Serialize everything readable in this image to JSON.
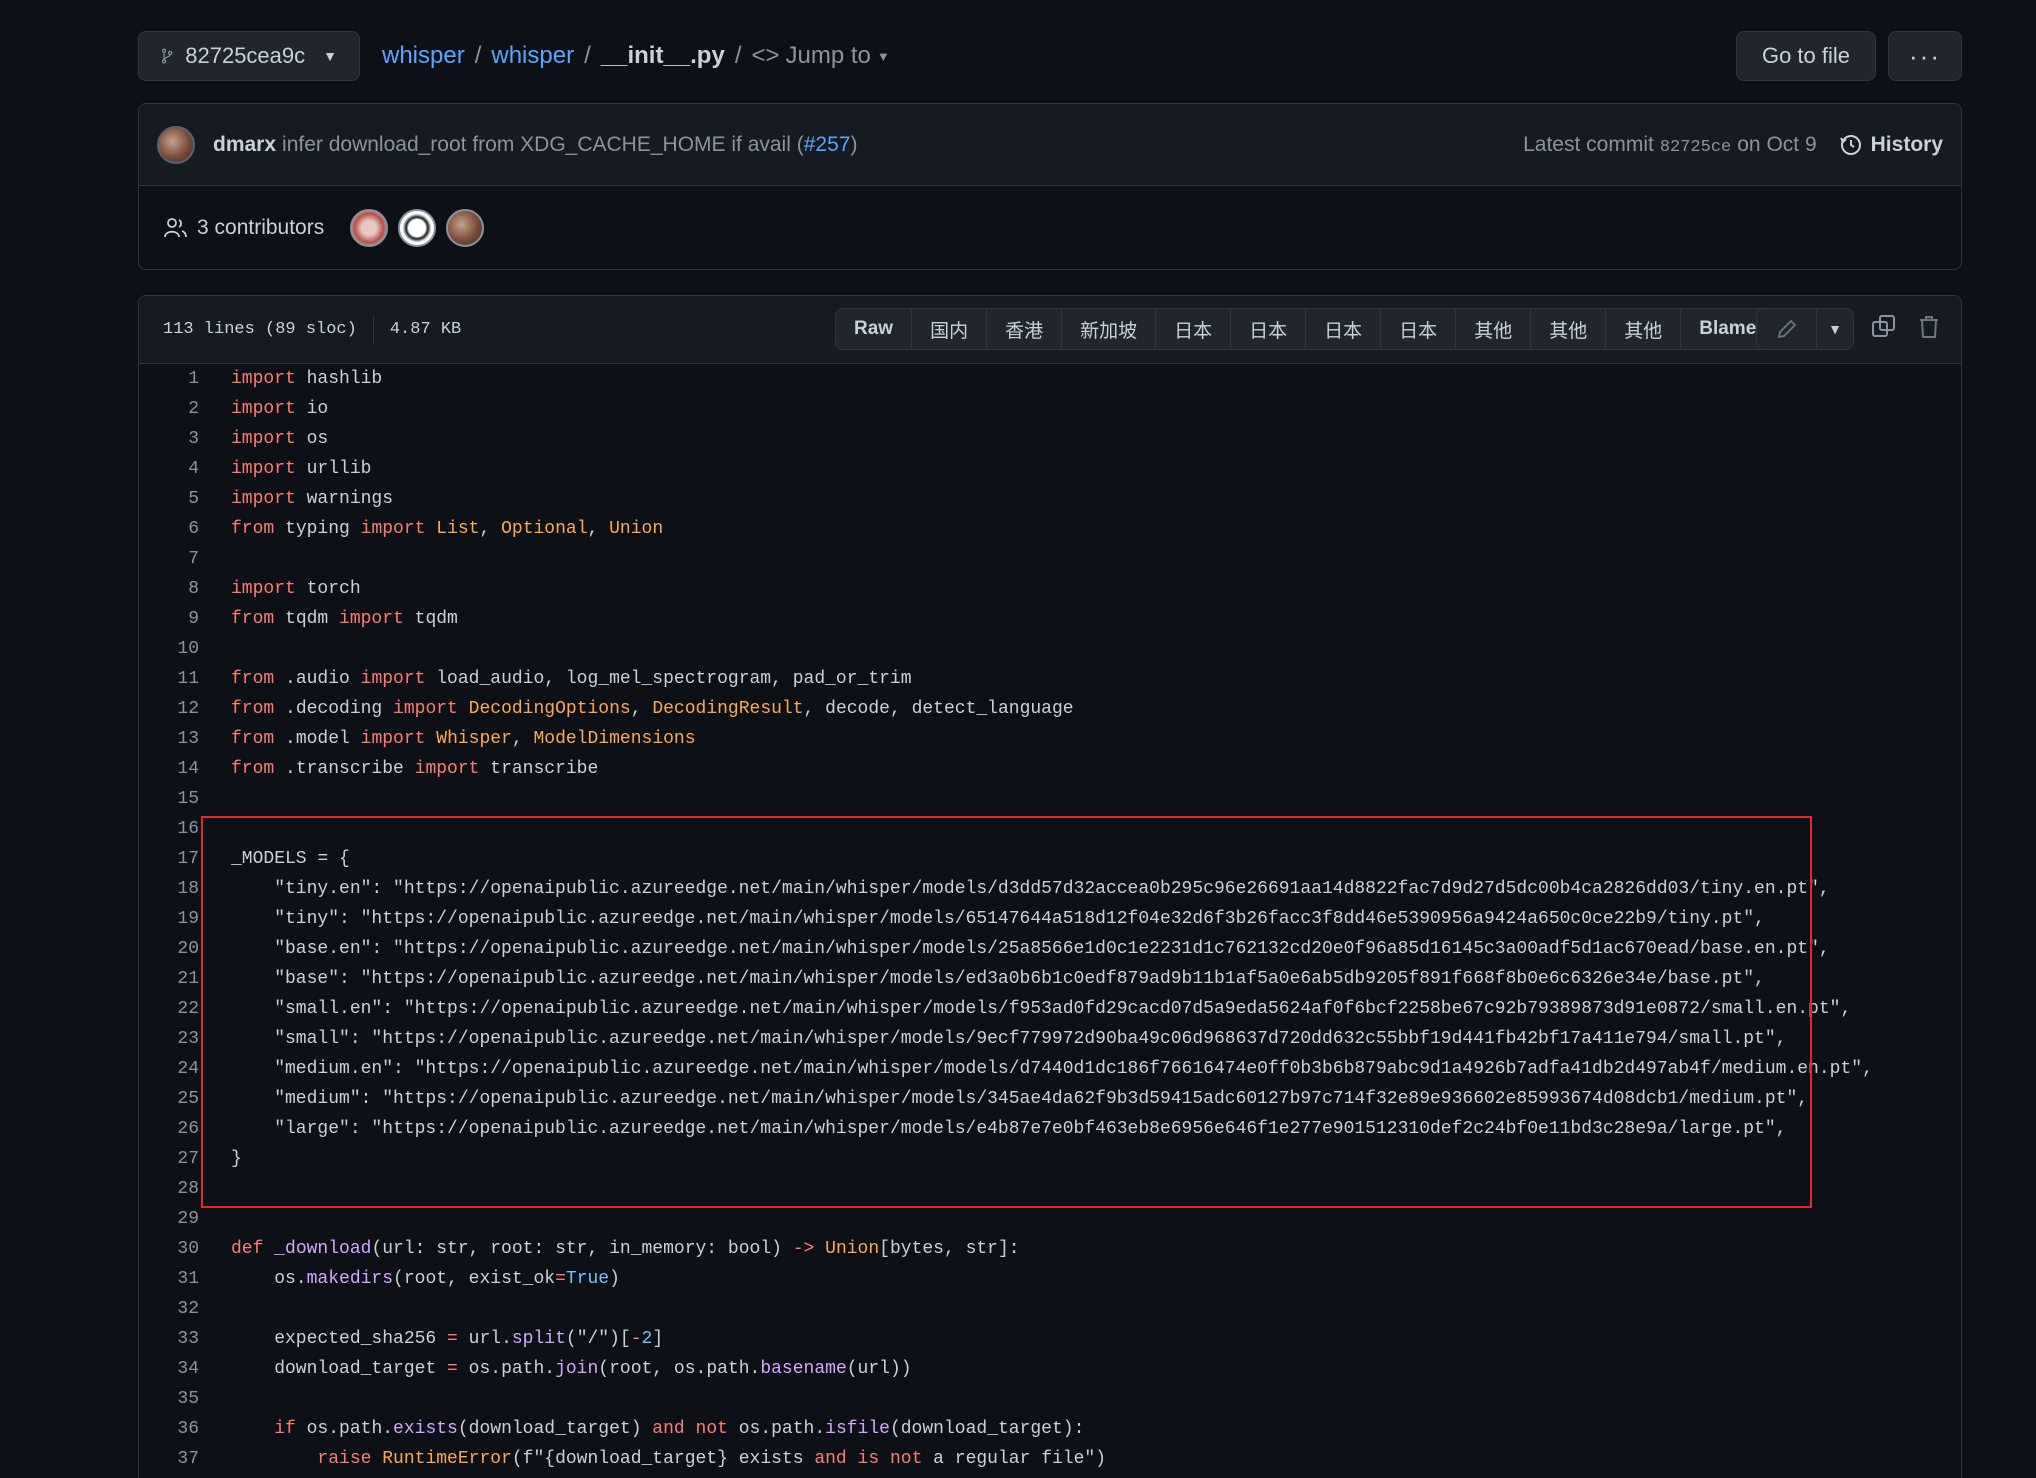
{
  "branch": {
    "name": "82725cea9c"
  },
  "breadcrumb": {
    "repo": "whisper",
    "folder": "whisper",
    "file": "__init__.py",
    "jump_to": "Jump to"
  },
  "toolbar": {
    "goto_file": "Go to file",
    "more": "···"
  },
  "commit": {
    "author": "dmarx",
    "message": "infer download_root from XDG_CACHE_HOME if avail (",
    "pr": "#257",
    "message_end": ")",
    "latest_label": "Latest commit",
    "sha": "82725ce",
    "date": "on Oct 9",
    "history": "History"
  },
  "contributors": {
    "label": "3 contributors"
  },
  "file_info": {
    "lines": "113 lines (89 sloc)",
    "size": "4.87 KB"
  },
  "view_buttons": [
    "Raw",
    "国内",
    "香港",
    "新加坡",
    "日本",
    "日本",
    "日本",
    "日本",
    "其他",
    "其他",
    "其他",
    "Blame"
  ],
  "code": [
    {
      "n": "1",
      "t": [
        [
          "kw",
          "import"
        ],
        [
          "",
          "hashlib"
        ]
      ]
    },
    {
      "n": "2",
      "t": [
        [
          "kw",
          "import"
        ],
        [
          "",
          "io"
        ]
      ]
    },
    {
      "n": "3",
      "t": [
        [
          "kw",
          "import"
        ],
        [
          "",
          "os"
        ]
      ]
    },
    {
      "n": "4",
      "t": [
        [
          "kw",
          "import"
        ],
        [
          "",
          "urllib"
        ]
      ]
    },
    {
      "n": "5",
      "t": [
        [
          "kw",
          "import"
        ],
        [
          "",
          "warnings"
        ]
      ]
    },
    {
      "n": "6",
      "t": [
        [
          "kw",
          "from"
        ],
        [
          "",
          " typing "
        ],
        [
          "kw",
          "import"
        ],
        [
          "",
          " "
        ],
        [
          "cls",
          "List"
        ],
        [
          "",
          ", "
        ],
        [
          "cls",
          "Optional"
        ],
        [
          "",
          ", "
        ],
        [
          "cls",
          "Union"
        ]
      ]
    },
    {
      "n": "7",
      "t": []
    },
    {
      "n": "8",
      "t": [
        [
          "kw",
          "import"
        ],
        [
          "",
          " torch"
        ]
      ]
    },
    {
      "n": "9",
      "t": [
        [
          "kw",
          "from"
        ],
        [
          "",
          " tqdm "
        ],
        [
          "kw",
          "import"
        ],
        [
          "",
          " tqdm"
        ]
      ]
    },
    {
      "n": "10",
      "t": []
    },
    {
      "n": "11",
      "t": [
        [
          "kw",
          "from"
        ],
        [
          "",
          " .audio "
        ],
        [
          "kw",
          "import"
        ],
        [
          "",
          " load_audio, log_mel_spectrogram, pad_or_trim"
        ]
      ]
    },
    {
      "n": "12",
      "t": [
        [
          "kw",
          "from"
        ],
        [
          "",
          " .decoding "
        ],
        [
          "kw",
          "import"
        ],
        [
          "",
          " "
        ],
        [
          "cls",
          "DecodingOptions"
        ],
        [
          "",
          ", "
        ],
        [
          "cls",
          "DecodingResult"
        ],
        [
          "",
          ", decode, detect_language"
        ]
      ]
    },
    {
      "n": "13",
      "t": [
        [
          "kw",
          "from"
        ],
        [
          "",
          " .model "
        ],
        [
          "kw",
          "import"
        ],
        [
          "",
          " "
        ],
        [
          "cls",
          "Whisper"
        ],
        [
          "",
          ", "
        ],
        [
          "cls",
          "ModelDimensions"
        ]
      ]
    },
    {
      "n": "14",
      "t": [
        [
          "kw",
          "from"
        ],
        [
          "",
          " .transcribe "
        ],
        [
          "kw",
          "import"
        ],
        [
          "",
          " transcribe"
        ]
      ]
    },
    {
      "n": "15",
      "t": []
    },
    {
      "n": "16",
      "t": []
    },
    {
      "n": "17",
      "t": [
        [
          "",
          "_MODELS = {"
        ]
      ]
    },
    {
      "n": "18",
      "t": [
        [
          "",
          "    \"tiny.en\": \"https://openaipublic.azureedge.net/main/whisper/models/d3dd57d32accea0b295c96e26691aa14d8822fac7d9d27d5dc00b4ca2826dd03/tiny.en.pt\","
        ]
      ]
    },
    {
      "n": "19",
      "t": [
        [
          "",
          "    \"tiny\": \"https://openaipublic.azureedge.net/main/whisper/models/65147644a518d12f04e32d6f3b26facc3f8dd46e5390956a9424a650c0ce22b9/tiny.pt\","
        ]
      ]
    },
    {
      "n": "20",
      "t": [
        [
          "",
          "    \"base.en\": \"https://openaipublic.azureedge.net/main/whisper/models/25a8566e1d0c1e2231d1c762132cd20e0f96a85d16145c3a00adf5d1ac670ead/base.en.pt\","
        ]
      ]
    },
    {
      "n": "21",
      "t": [
        [
          "",
          "    \"base\": \"https://openaipublic.azureedge.net/main/whisper/models/ed3a0b6b1c0edf879ad9b11b1af5a0e6ab5db9205f891f668f8b0e6c6326e34e/base.pt\","
        ]
      ]
    },
    {
      "n": "22",
      "t": [
        [
          "",
          "    \"small.en\": \"https://openaipublic.azureedge.net/main/whisper/models/f953ad0fd29cacd07d5a9eda5624af0f6bcf2258be67c92b79389873d91e0872/small.en.pt\","
        ]
      ]
    },
    {
      "n": "23",
      "t": [
        [
          "",
          "    \"small\": \"https://openaipublic.azureedge.net/main/whisper/models/9ecf779972d90ba49c06d968637d720dd632c55bbf19d441fb42bf17a411e794/small.pt\","
        ]
      ]
    },
    {
      "n": "24",
      "t": [
        [
          "",
          "    \"medium.en\": \"https://openaipublic.azureedge.net/main/whisper/models/d7440d1dc186f76616474e0ff0b3b6b879abc9d1a4926b7adfa41db2d497ab4f/medium.en.pt\","
        ]
      ]
    },
    {
      "n": "25",
      "t": [
        [
          "",
          "    \"medium\": \"https://openaipublic.azureedge.net/main/whisper/models/345ae4da62f9b3d59415adc60127b97c714f32e89e936602e85993674d08dcb1/medium.pt\","
        ]
      ]
    },
    {
      "n": "26",
      "t": [
        [
          "",
          "    \"large\": \"https://openaipublic.azureedge.net/main/whisper/models/e4b87e7e0bf463eb8e6956e646f1e277e901512310def2c24bf0e11bd3c28e9a/large.pt\","
        ]
      ]
    },
    {
      "n": "27",
      "t": [
        [
          "",
          "}"
        ]
      ]
    },
    {
      "n": "28",
      "t": []
    },
    {
      "n": "29",
      "t": []
    },
    {
      "n": "30",
      "t": [
        [
          "kw",
          "def"
        ],
        [
          "",
          " "
        ],
        [
          "fn",
          "_download"
        ],
        [
          "",
          "(url: str, root: str, in_memory: bool) "
        ],
        [
          "kw",
          "->"
        ],
        [
          "",
          " "
        ],
        [
          "cls",
          "Union"
        ],
        [
          "",
          "[bytes, str]:"
        ]
      ]
    },
    {
      "n": "31",
      "t": [
        [
          "",
          "    os."
        ],
        [
          "fn",
          "makedirs"
        ],
        [
          "",
          "(root, exist_ok"
        ],
        [
          "kw",
          "="
        ],
        [
          "cst",
          "True"
        ],
        [
          "",
          ")"
        ]
      ]
    },
    {
      "n": "32",
      "t": []
    },
    {
      "n": "33",
      "t": [
        [
          "",
          "    expected_sha256 "
        ],
        [
          "kw",
          "="
        ],
        [
          "",
          " url."
        ],
        [
          "fn",
          "split"
        ],
        [
          "",
          "(\"/\")["
        ],
        [
          "kw",
          "-"
        ],
        [
          "cst",
          "2"
        ],
        [
          "",
          "]"
        ]
      ]
    },
    {
      "n": "34",
      "t": [
        [
          "",
          "    download_target "
        ],
        [
          "kw",
          "="
        ],
        [
          "",
          " os.path."
        ],
        [
          "fn",
          "join"
        ],
        [
          "",
          "(root, os.path."
        ],
        [
          "fn",
          "basename"
        ],
        [
          "",
          "(url))"
        ]
      ]
    },
    {
      "n": "35",
      "t": []
    },
    {
      "n": "36",
      "t": [
        [
          "",
          "    "
        ],
        [
          "kw",
          "if"
        ],
        [
          "",
          " os.path."
        ],
        [
          "fn",
          "exists"
        ],
        [
          "",
          "(download_target) "
        ],
        [
          "kw",
          "and"
        ],
        [
          "",
          " "
        ],
        [
          "kw",
          "not"
        ],
        [
          "",
          " os.path."
        ],
        [
          "fn",
          "isfile"
        ],
        [
          "",
          "(download_target):"
        ]
      ]
    },
    {
      "n": "37",
      "t": [
        [
          "",
          "        "
        ],
        [
          "kw",
          "raise"
        ],
        [
          "",
          " "
        ],
        [
          "cls",
          "RuntimeError"
        ],
        [
          "",
          "(f\"{download_target} exists "
        ],
        [
          "kw",
          "and"
        ],
        [
          "",
          " "
        ],
        [
          "kw",
          "is"
        ],
        [
          "",
          " "
        ],
        [
          "kw",
          "not"
        ],
        [
          "",
          " a regular file\")"
        ]
      ]
    }
  ]
}
